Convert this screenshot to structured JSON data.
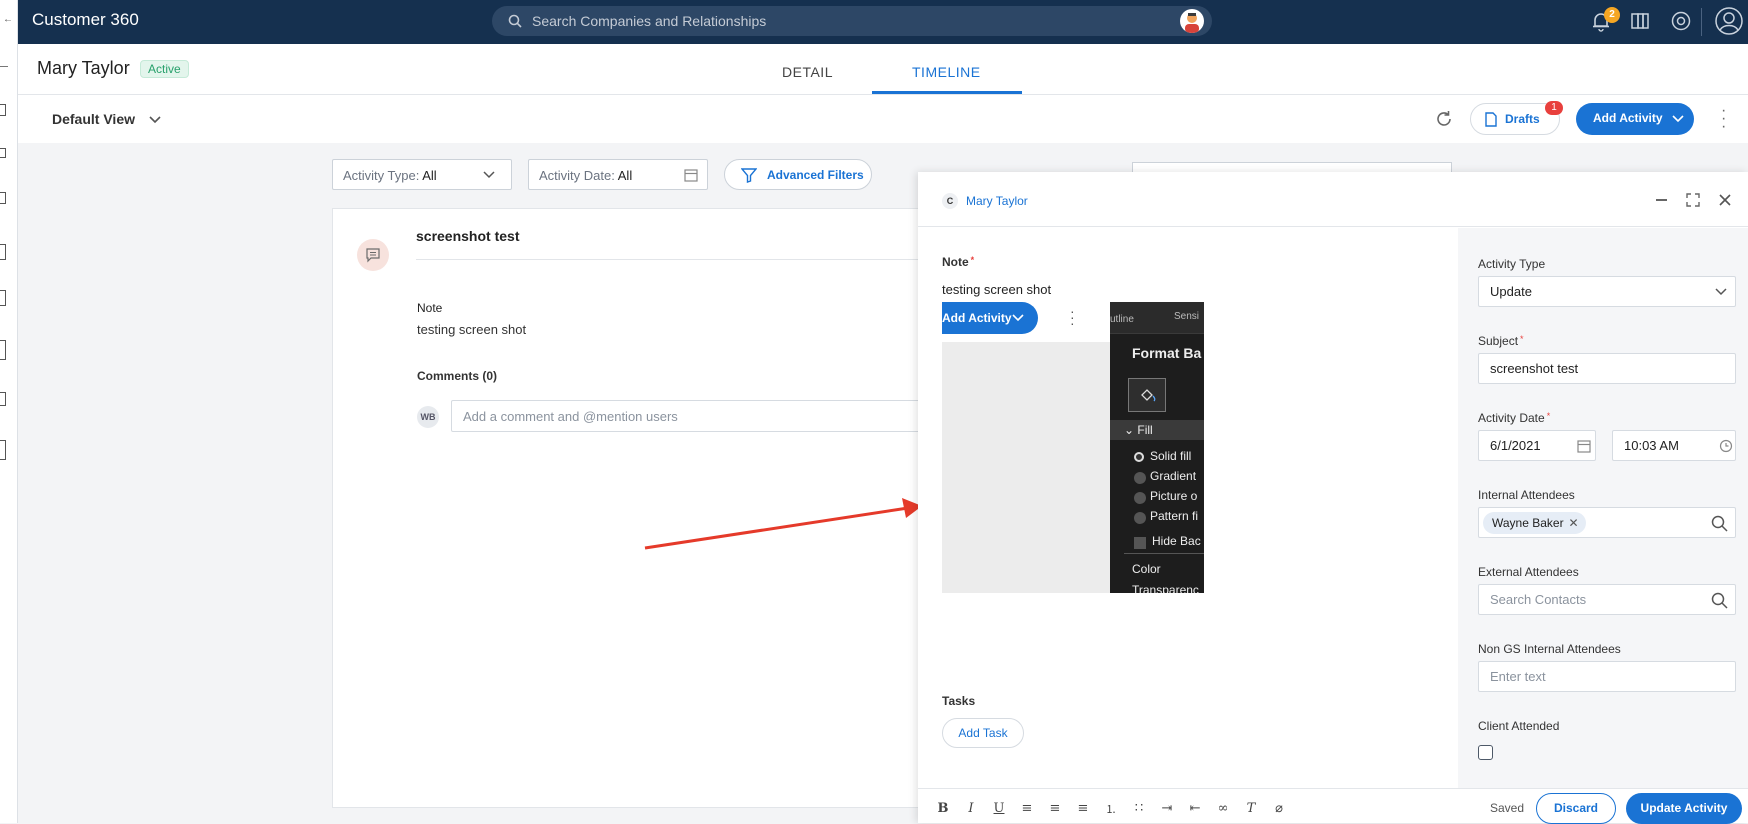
{
  "app": {
    "title": "Customer 360",
    "search_placeholder": "Search Companies and Relationships",
    "notification_count": "2"
  },
  "header": {
    "person_name": "Mary Taylor",
    "status": "Active",
    "tabs": [
      "DETAIL",
      "TIMELINE"
    ],
    "active_tab": "TIMELINE"
  },
  "toolbar": {
    "view": "Default View",
    "drafts_label": "Drafts",
    "drafts_count": "1",
    "add_activity_label": "Add Activity"
  },
  "filters": {
    "activity_type_label": "Activity Type:",
    "activity_type_value": "All",
    "activity_date_label": "Activity Date:",
    "activity_date_value": "All",
    "advanced_label": "Advanced Filters"
  },
  "timeline_card": {
    "title": "screenshot test",
    "note_label": "Note",
    "note_text": "testing screen shot",
    "comments_label": "Comments (0)",
    "commenter_initials": "WB",
    "comment_placeholder": "Add a comment and @mention users"
  },
  "drawer": {
    "company_initial": "C",
    "person_name": "Mary Taylor",
    "note_label": "Note",
    "note_text": "testing screen shot",
    "screenshot": {
      "button_label": "Add Activity",
      "tab_labels": [
        "utline",
        "Sensi"
      ],
      "panel_title": "Format Ba",
      "section_label": "Fill",
      "options": [
        "Solid fill",
        "Gradient",
        "Picture o",
        "Pattern fi"
      ],
      "checkbox_label": "Hide Bac",
      "color_label": "Color",
      "transparency_label": "Transparenc"
    },
    "tasks_label": "Tasks",
    "add_task_label": "Add Task",
    "side": {
      "activity_type_label": "Activity Type",
      "activity_type_value": "Update",
      "subject_label": "Subject",
      "subject_value": "screenshot test",
      "activity_date_label": "Activity Date",
      "date_value": "6/1/2021",
      "time_value": "10:03 AM",
      "internal_attendees_label": "Internal Attendees",
      "internal_attendee": "Wayne Baker",
      "external_attendees_label": "External Attendees",
      "external_placeholder": "Search Contacts",
      "non_gs_label": "Non GS Internal Attendees",
      "non_gs_placeholder": "Enter text",
      "client_attended_label": "Client Attended"
    },
    "footer": {
      "saved_text": "Saved",
      "discard_label": "Discard",
      "update_label": "Update Activity"
    }
  },
  "colors": {
    "primary": "#1a73d4",
    "topbar": "#15304f",
    "badge_green": "#27a06b",
    "alert_red": "#e8403d",
    "arrow_red": "#e53a2a"
  }
}
